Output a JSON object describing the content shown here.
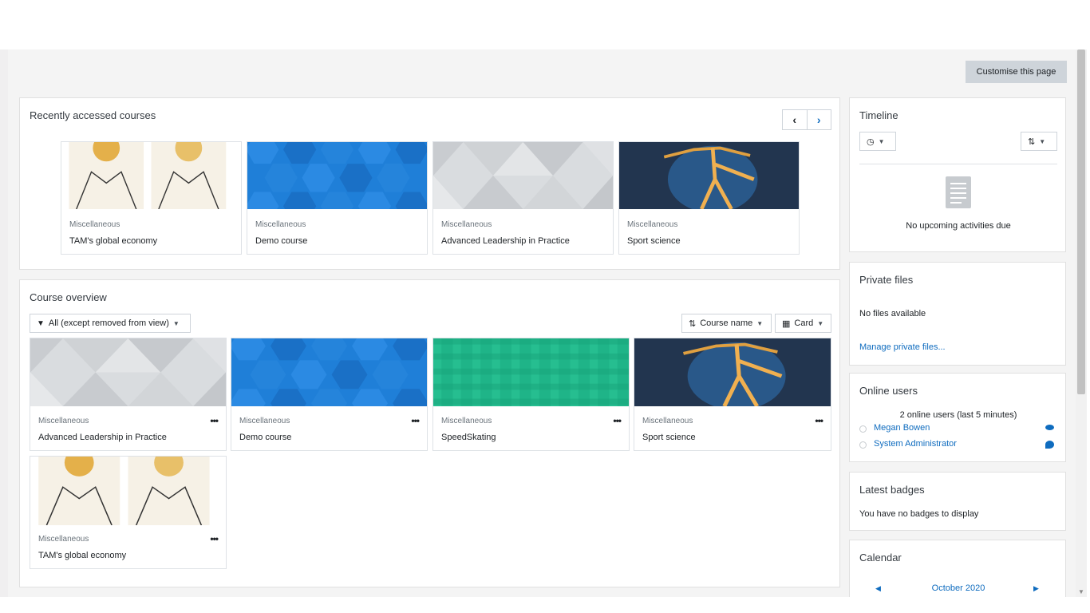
{
  "header": {
    "customise_label": "Customise this page"
  },
  "recent": {
    "title": "Recently accessed courses",
    "courses": [
      {
        "category": "Miscellaneous",
        "name": "TAM's global economy",
        "image": "portrait"
      },
      {
        "category": "Miscellaneous",
        "name": "Demo course",
        "image": "blue-hex"
      },
      {
        "category": "Miscellaneous",
        "name": "Advanced Leadership in Practice",
        "image": "grey-triangles"
      },
      {
        "category": "Miscellaneous",
        "name": "Sport science",
        "image": "skeleton"
      }
    ]
  },
  "overview": {
    "title": "Course overview",
    "filter_label": "All (except removed from view)",
    "sort_label": "Course name",
    "view_label": "Card",
    "more_label": "•••",
    "courses": [
      {
        "category": "Miscellaneous",
        "name": "Advanced Leadership in Practice",
        "image": "grey-triangles"
      },
      {
        "category": "Miscellaneous",
        "name": "Demo course",
        "image": "blue-hex"
      },
      {
        "category": "Miscellaneous",
        "name": "SpeedSkating",
        "image": "green-plaid"
      },
      {
        "category": "Miscellaneous",
        "name": "Sport science",
        "image": "skeleton"
      },
      {
        "category": "Miscellaneous",
        "name": "TAM's global economy",
        "image": "portrait"
      }
    ]
  },
  "timeline": {
    "title": "Timeline",
    "empty_text": "No upcoming activities due"
  },
  "private_files": {
    "title": "Private files",
    "empty_text": "No files available",
    "manage_link": "Manage private files..."
  },
  "online_users": {
    "title": "Online users",
    "summary": "2 online users (last 5 minutes)",
    "users": [
      "Megan Bowen",
      "System Administrator"
    ]
  },
  "badges": {
    "title": "Latest badges",
    "empty_text": "You have no badges to display"
  },
  "calendar": {
    "title": "Calendar",
    "month": "October 2020"
  },
  "colors": {
    "accent": "#0f6cbf",
    "page_bg": "#f4f4f4",
    "button_bg": "#ced4da"
  }
}
